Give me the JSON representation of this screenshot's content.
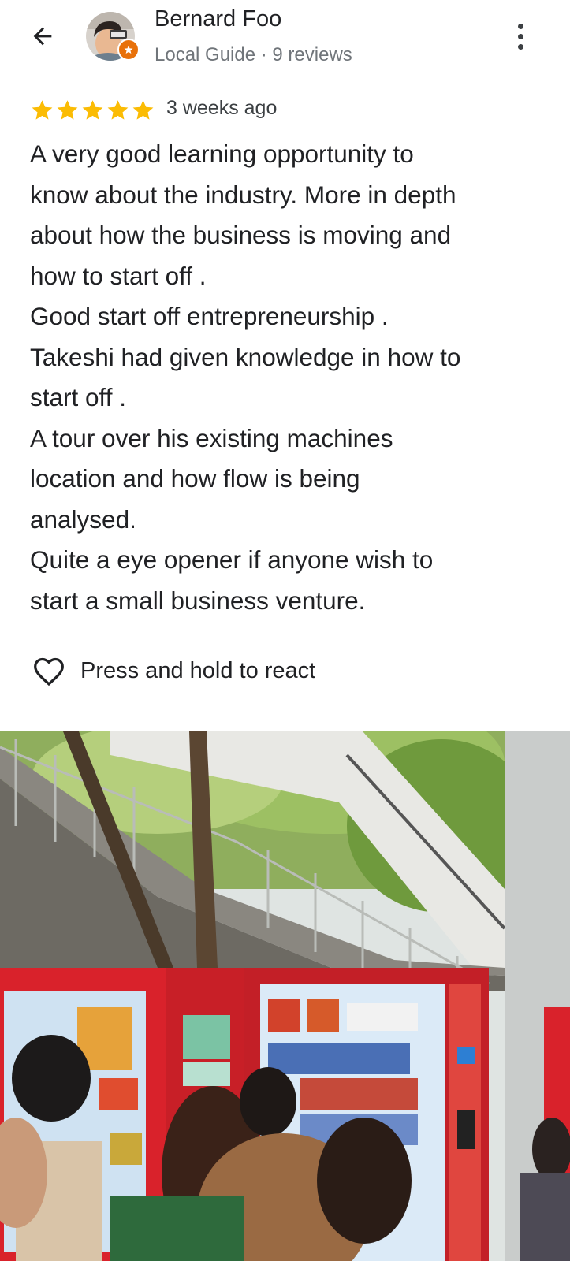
{
  "header": {
    "reviewer_name": "Bernard Foo",
    "reviewer_meta": "Local Guide · 9 reviews",
    "back_icon": "arrow-back-icon",
    "more_icon": "more-vert-icon",
    "badge_icon": "local-guide-star-icon"
  },
  "rating": {
    "stars": 5,
    "time_ago": "3 weeks ago",
    "star_color": "#fbbc04"
  },
  "review": {
    "lines": [
      "A very good learning opportunity to",
      "know about the industry. More in depth",
      "about how the business is moving and",
      "how to start off .",
      "Good start off entrepreneurship .",
      "Takeshi had given knowledge in how to",
      "start off .",
      "A tour over his existing machines",
      "location and how flow is being",
      "analysed.",
      "Quite a eye opener if anyone wish to",
      "start a small business venture."
    ]
  },
  "reaction": {
    "label": "Press and hold to react",
    "icon": "heart-outline-icon"
  },
  "photo": {
    "subject": "people gathered around red vending machines under a covered staircase"
  },
  "colors": {
    "text_primary": "#202124",
    "text_secondary": "#70757a",
    "badge": "#e8710a",
    "vending_red": "#d9222b"
  }
}
